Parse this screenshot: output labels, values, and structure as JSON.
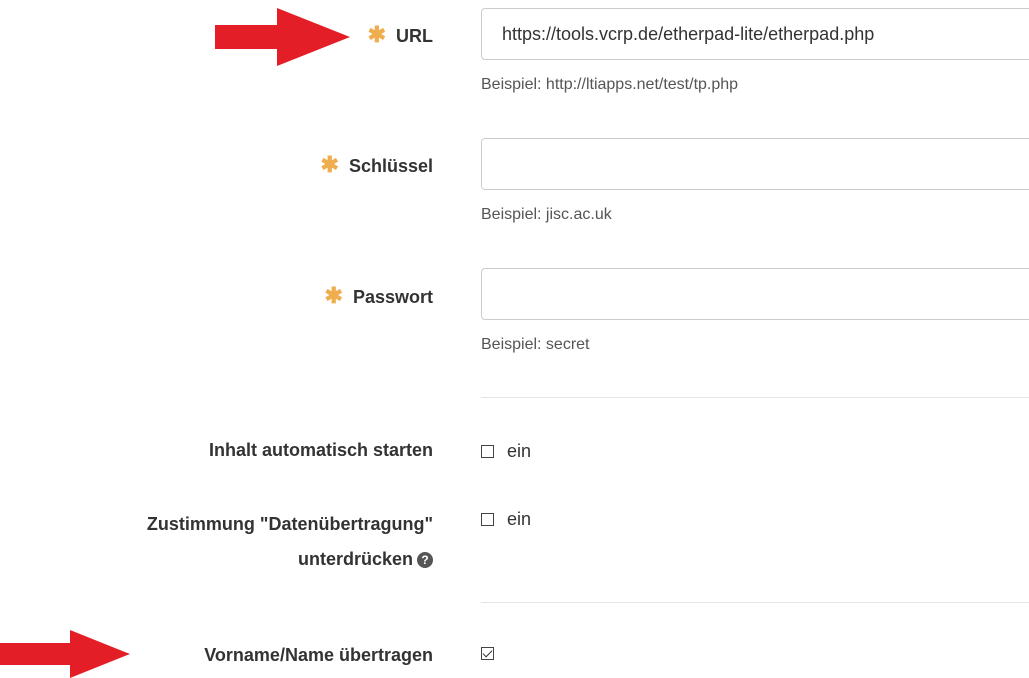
{
  "form": {
    "url": {
      "label": "URL",
      "required_icon": "asterisk-icon",
      "value": "https://tools.vcrp.de/etherpad-lite/etherpad.php",
      "help": "Beispiel: http://ltiapps.net/test/tp.php"
    },
    "key": {
      "label": "Schlüssel",
      "required_icon": "asterisk-icon",
      "value": "",
      "help": "Beispiel: jisc.ac.uk"
    },
    "password": {
      "label": "Passwort",
      "required_icon": "asterisk-icon",
      "value": "",
      "help": "Beispiel: secret"
    },
    "autostart": {
      "label": "Inhalt automatisch starten",
      "checkbox_label": "ein",
      "checked": false
    },
    "consent": {
      "label_line1": "Zustimmung \"Datenübertragung\"",
      "label_line2": "unterdrücken",
      "checkbox_label": "ein",
      "checked": false,
      "help_icon": "question-circle-icon"
    },
    "send_name": {
      "label": "Vorname/Name übertragen",
      "checked": true
    }
  },
  "annotations": {
    "arrow_color": "#e41e26",
    "arrow_icon": "red-arrow-icon"
  },
  "colors": {
    "required": "#f0ad4e",
    "text": "#333333",
    "help_text": "#555555",
    "input_border": "#cccccc"
  }
}
